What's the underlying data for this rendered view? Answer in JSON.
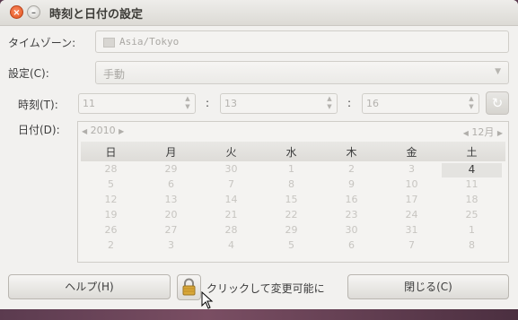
{
  "window": {
    "title": "時刻と日付の設定",
    "close_glyph": "×",
    "minimize_glyph": "–"
  },
  "timezone": {
    "label": "タイムゾーン:",
    "value": "Asia/Tokyo"
  },
  "setting": {
    "label": "設定(C):",
    "value": "手動"
  },
  "time": {
    "label": "時刻(T):",
    "hour": "11",
    "minute": "13",
    "second": "16",
    "separator": ":"
  },
  "date_label": "日付(D):",
  "calendar": {
    "year": "2010",
    "month": "12月",
    "weekdays": [
      "日",
      "月",
      "火",
      "水",
      "木",
      "金",
      "土"
    ],
    "weeks": [
      [
        "28",
        "29",
        "30",
        "1",
        "2",
        "3",
        "4"
      ],
      [
        "5",
        "6",
        "7",
        "8",
        "9",
        "10",
        "11"
      ],
      [
        "12",
        "13",
        "14",
        "15",
        "16",
        "17",
        "18"
      ],
      [
        "19",
        "20",
        "21",
        "22",
        "23",
        "24",
        "25"
      ],
      [
        "26",
        "27",
        "28",
        "29",
        "30",
        "31",
        "1"
      ],
      [
        "2",
        "3",
        "4",
        "5",
        "6",
        "7",
        "8"
      ]
    ],
    "selected_day": "4"
  },
  "buttons": {
    "help": "ヘルプ(H)",
    "unlock_text": "クリックして変更可能に",
    "close": "閉じる(C)"
  },
  "icons": {
    "spin_up": "▲",
    "spin_down": "▼",
    "prev": "◀",
    "next": "▶",
    "combo_arrow": "▼",
    "refresh": "↻"
  }
}
